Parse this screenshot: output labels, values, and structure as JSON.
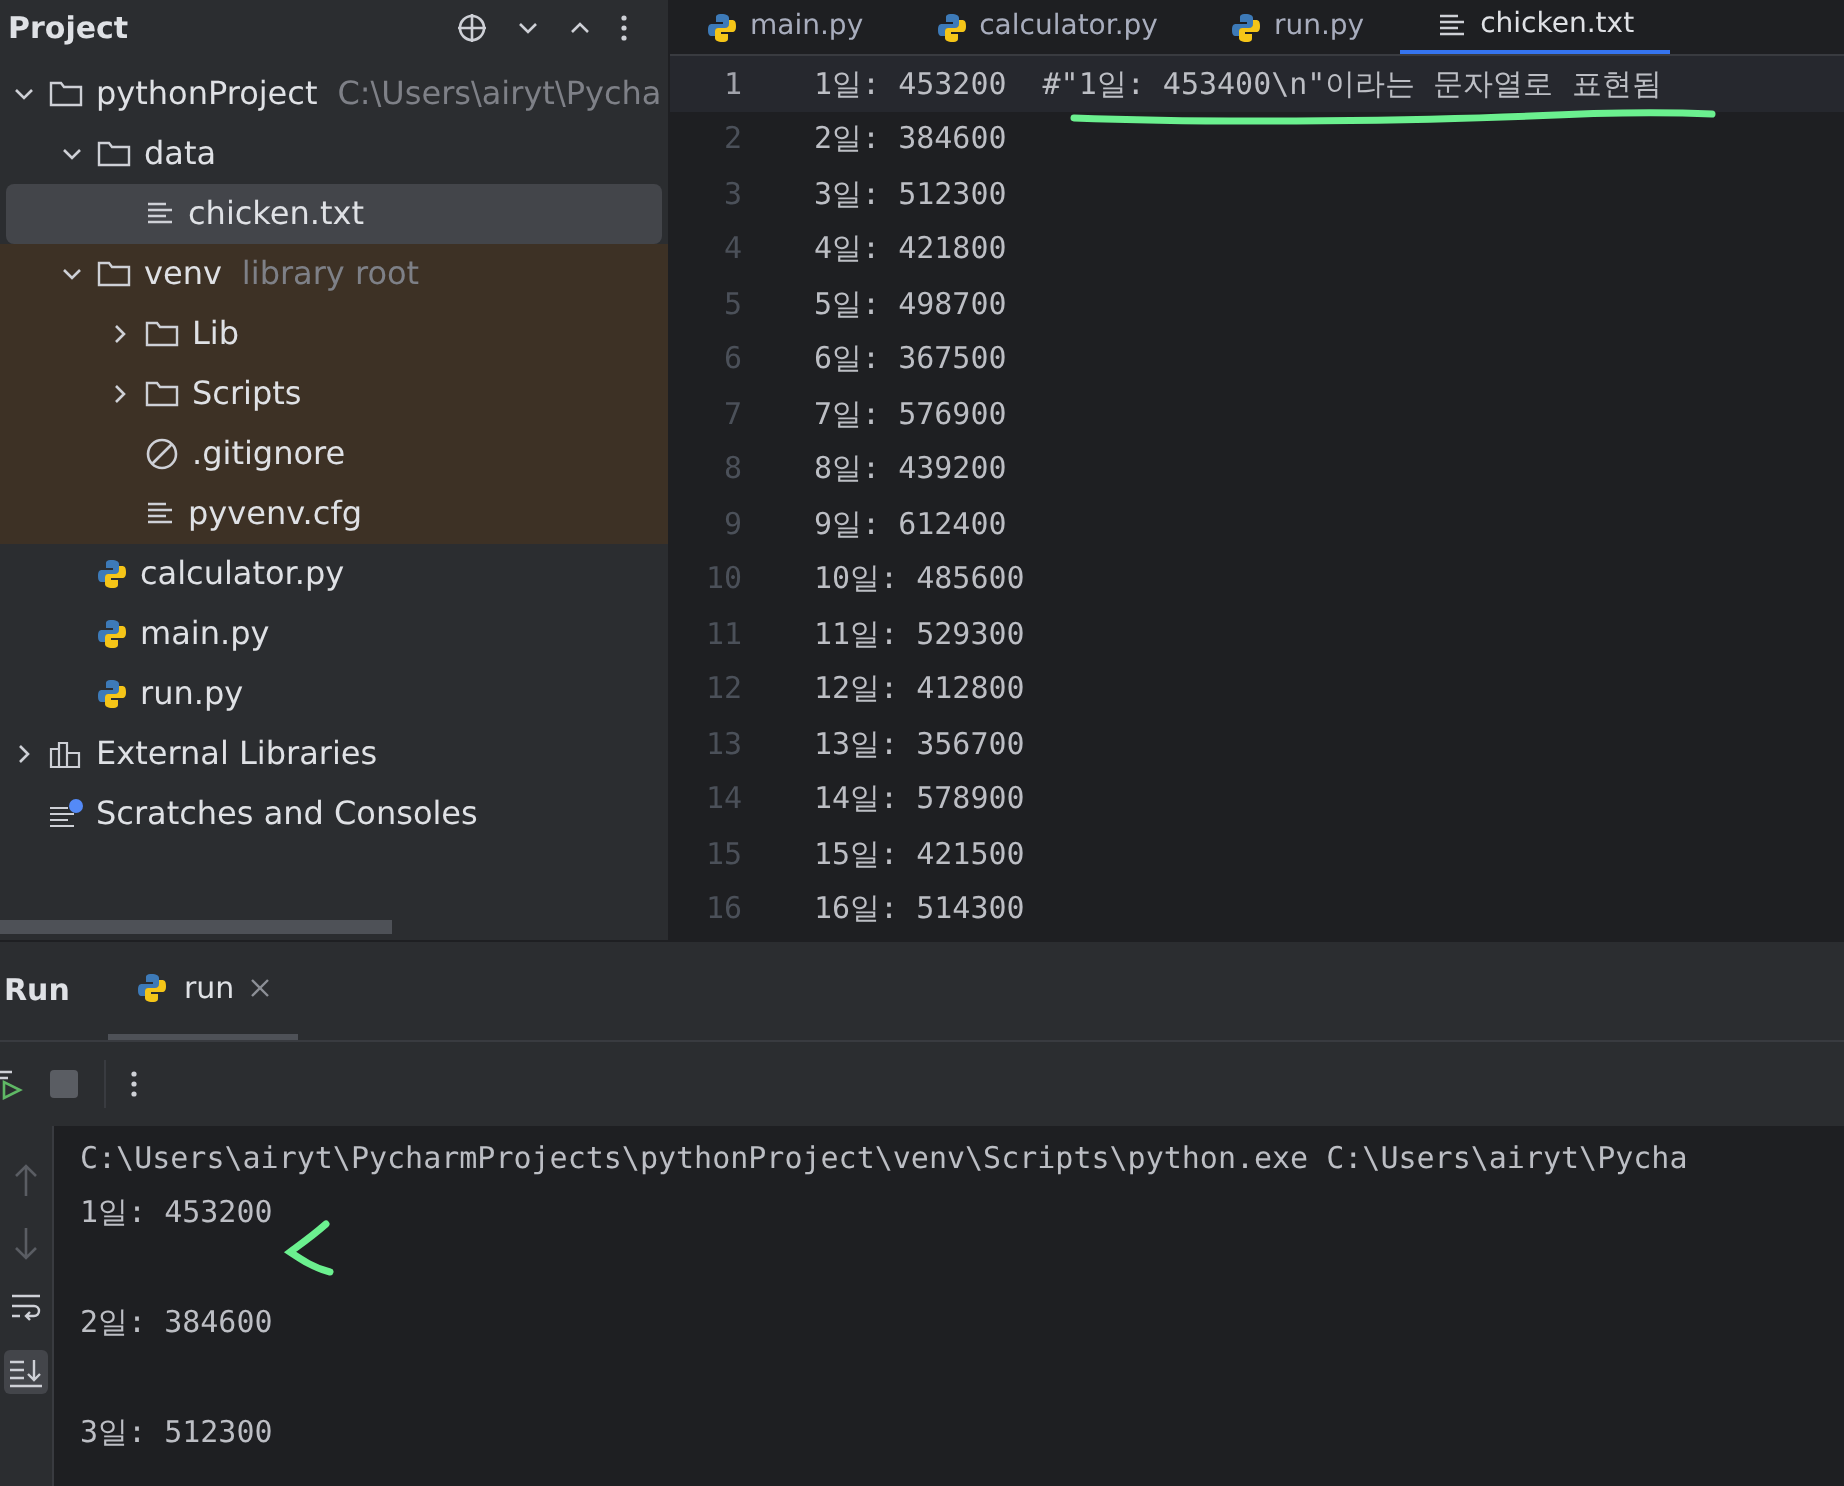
{
  "project_panel": {
    "title": "Project"
  },
  "tree": [
    {
      "label": "pythonProject",
      "hint": "C:\\Users\\airyt\\Pycha",
      "kind": "folder",
      "expanded": true,
      "selected": false,
      "children": [
        {
          "label": "data",
          "kind": "folder",
          "expanded": true,
          "selected": false,
          "children": [
            {
              "label": "chicken.txt",
              "kind": "text",
              "selected": true
            }
          ]
        },
        {
          "label": "venv",
          "hint": "library root",
          "kind": "library",
          "expanded": true,
          "selected": false,
          "children": [
            {
              "label": "Lib",
              "kind": "folder",
              "expanded": false,
              "selected": false
            },
            {
              "label": "Scripts",
              "kind": "folder",
              "expanded": false,
              "selected": false
            },
            {
              "label": ".gitignore",
              "kind": "ignore",
              "selected": false
            },
            {
              "label": "pyvenv.cfg",
              "kind": "text",
              "selected": false
            }
          ]
        },
        {
          "label": "calculator.py",
          "kind": "python",
          "selected": false
        },
        {
          "label": "main.py",
          "kind": "python",
          "selected": false
        },
        {
          "label": "run.py",
          "kind": "python",
          "selected": false
        }
      ]
    },
    {
      "label": "External Libraries",
      "kind": "libraries",
      "expanded": false,
      "selected": false
    },
    {
      "label": "Scratches and Consoles",
      "kind": "scratches",
      "selected": false
    }
  ],
  "editor_tabs": [
    {
      "label": "main.py",
      "kind": "python",
      "selected": false
    },
    {
      "label": "calculator.py",
      "kind": "python",
      "selected": false
    },
    {
      "label": "run.py",
      "kind": "python",
      "selected": false
    },
    {
      "label": "chicken.txt",
      "kind": "text",
      "selected": true
    }
  ],
  "editor_lines": [
    {
      "number": "1",
      "text": "1일: 453200",
      "comment": "#\"1일: 453400\\n\"이라는 문자열로 표현됨",
      "current": true
    },
    {
      "number": "2",
      "text": "2일: 384600",
      "current": false
    },
    {
      "number": "3",
      "text": "3일: 512300",
      "current": false
    },
    {
      "number": "4",
      "text": "4일: 421800",
      "current": false
    },
    {
      "number": "5",
      "text": "5일: 498700",
      "current": false
    },
    {
      "number": "6",
      "text": "6일: 367500",
      "current": false
    },
    {
      "number": "7",
      "text": "7일: 576900",
      "current": false
    },
    {
      "number": "8",
      "text": "8일: 439200",
      "current": false
    },
    {
      "number": "9",
      "text": "9일: 612400",
      "current": false
    },
    {
      "number": "10",
      "text": "10일: 485600",
      "current": false
    },
    {
      "number": "11",
      "text": "11일: 529300",
      "current": false
    },
    {
      "number": "12",
      "text": "12일: 412800",
      "current": false
    },
    {
      "number": "13",
      "text": "13일: 356700",
      "current": false
    },
    {
      "number": "14",
      "text": "14일: 578900",
      "current": false
    },
    {
      "number": "15",
      "text": "15일: 421500",
      "current": false
    },
    {
      "number": "16",
      "text": "16일: 514300",
      "current": false
    }
  ],
  "run_panel": {
    "title": "Run",
    "tabs": [
      {
        "label": "run",
        "selected": true
      }
    ],
    "console": [
      {
        "kind": "command",
        "text": "C:\\Users\\airyt\\PycharmProjects\\pythonProject\\venv\\Scripts\\python.exe C:\\Users\\airyt\\Pycha"
      },
      {
        "kind": "output",
        "text": "1일: 453200"
      },
      {
        "kind": "output",
        "text": "2일: 384600"
      },
      {
        "kind": "output",
        "text": "3일: 512300"
      }
    ]
  }
}
